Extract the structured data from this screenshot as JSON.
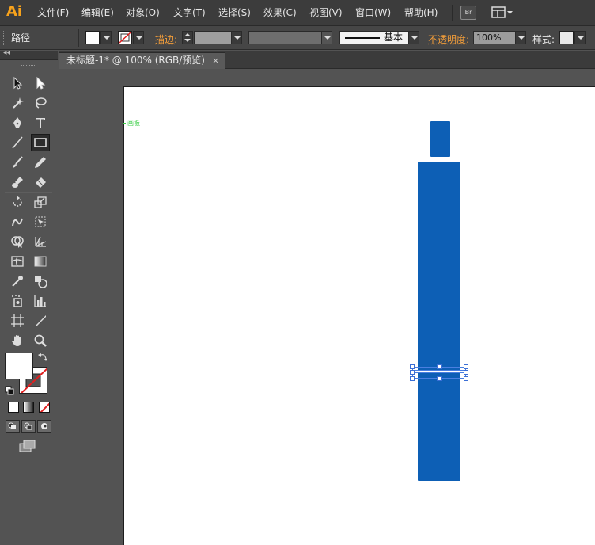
{
  "app": {
    "logo": "Ai",
    "menus": [
      "文件(F)",
      "编辑(E)",
      "对象(O)",
      "文字(T)",
      "选择(S)",
      "效果(C)",
      "视图(V)",
      "窗口(W)",
      "帮助(H)"
    ],
    "bridge_label": "Br"
  },
  "control": {
    "selection_type": "路径",
    "stroke_label": "描边:",
    "stroke_profile": "基本",
    "opacity_label": "不透明度:",
    "opacity_value": "100%",
    "style_label": "样式:"
  },
  "document": {
    "tab_title": "未标题-1* @ 100% (RGB/预览)",
    "tab_close": "×",
    "artboard_label": "画板"
  },
  "colors": {
    "shape_fill": "#0d5fb5",
    "accent_orange": "#f09c3a",
    "logo_orange": "#f7a21b",
    "selection_blue": "#4a7fe0"
  },
  "tools": [
    "selection-tool",
    "direct-selection-tool",
    "magic-wand-tool",
    "lasso-tool",
    "pen-tool",
    "type-tool",
    "line-segment-tool",
    "rectangle-tool",
    "paintbrush-tool",
    "pencil-tool",
    "blob-brush-tool",
    "eraser-tool",
    "rotate-tool",
    "scale-tool",
    "warp-tool",
    "free-transform-tool",
    "shape-builder-tool",
    "perspective-grid-tool",
    "mesh-tool",
    "gradient-tool",
    "eyedropper-tool",
    "blend-tool",
    "symbol-sprayer-tool",
    "column-graph-tool",
    "artboard-tool",
    "slice-tool",
    "hand-tool",
    "zoom-tool"
  ]
}
